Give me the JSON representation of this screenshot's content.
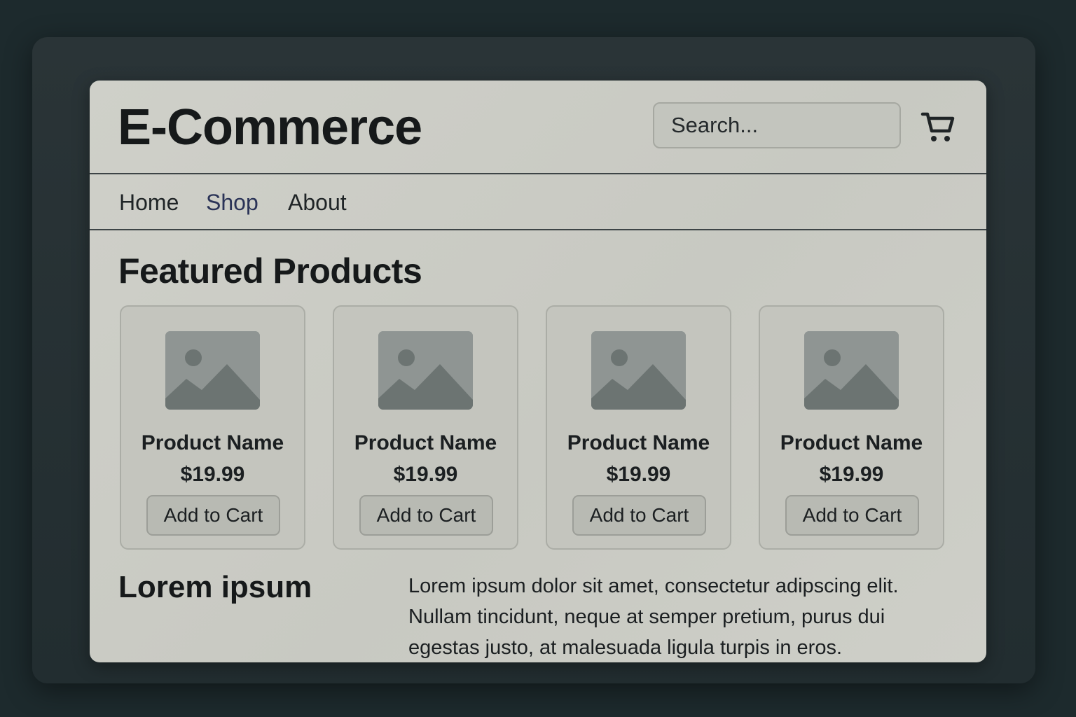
{
  "header": {
    "brand": "E-Commerce",
    "search_placeholder": "Search...",
    "cart_icon": "shopping-cart-icon"
  },
  "nav": {
    "items": [
      {
        "label": "Home",
        "active": false
      },
      {
        "label": "Shop",
        "active": true
      },
      {
        "label": "About",
        "active": false
      }
    ]
  },
  "main": {
    "section_title": "Featured Products",
    "products": [
      {
        "name": "Product Name",
        "price": "$19.99",
        "button_label": "Add to Cart",
        "image_icon": "image-placeholder-icon"
      },
      {
        "name": "Product Name",
        "price": "$19.99",
        "button_label": "Add to Cart",
        "image_icon": "image-placeholder-icon"
      },
      {
        "name": "Product Name",
        "price": "$19.99",
        "button_label": "Add to Cart",
        "image_icon": "image-placeholder-icon"
      },
      {
        "name": "Product Name",
        "price": "$19.99",
        "button_label": "Add to Cart",
        "image_icon": "image-placeholder-icon"
      }
    ],
    "info": {
      "title": "Lorem ipsum",
      "body": "Lorem ipsum dolor sit amet, consectetur adipscing elit. Nullam tincidunt, neque at semper pretium, purus dui egestas justo, at malesuada ligula turpis in eros."
    }
  },
  "colors": {
    "page_background": "#1d2a2d",
    "window_background": "#cfd0c9",
    "nav_active": "#2a3357",
    "placeholder_image": "#8f9593"
  }
}
